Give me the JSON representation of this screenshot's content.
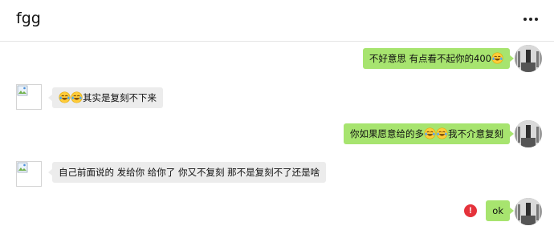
{
  "chat": {
    "title": "fgg",
    "more_icon": "more-horizontal-icon"
  },
  "messages": [
    {
      "side": "out",
      "text": "不好意思 有点看不起你的400",
      "trailing_emoji": [
        "laugh-cry-emoji"
      ]
    },
    {
      "side": "in",
      "leading_emoji": [
        "laugh-cry-emoji",
        "laugh-cry-emoji"
      ],
      "text": "其实是复刻不下来"
    },
    {
      "side": "out",
      "text_before": "你如果愿意给的多",
      "emoji": [
        "laugh-cry-emoji",
        "laugh-cry-emoji"
      ],
      "text_after": "我不介意复刻"
    },
    {
      "side": "in",
      "text": "自己前面说的 发给你 给你了 你又不复刻 那不是复刻不了还是啥"
    },
    {
      "side": "out",
      "text": "ok",
      "status": "send-failed",
      "status_icon": "!"
    }
  ],
  "colors": {
    "outgoing_bubble": "#a7e46f",
    "incoming_bubble": "#ececec",
    "error": "#e5323b"
  }
}
